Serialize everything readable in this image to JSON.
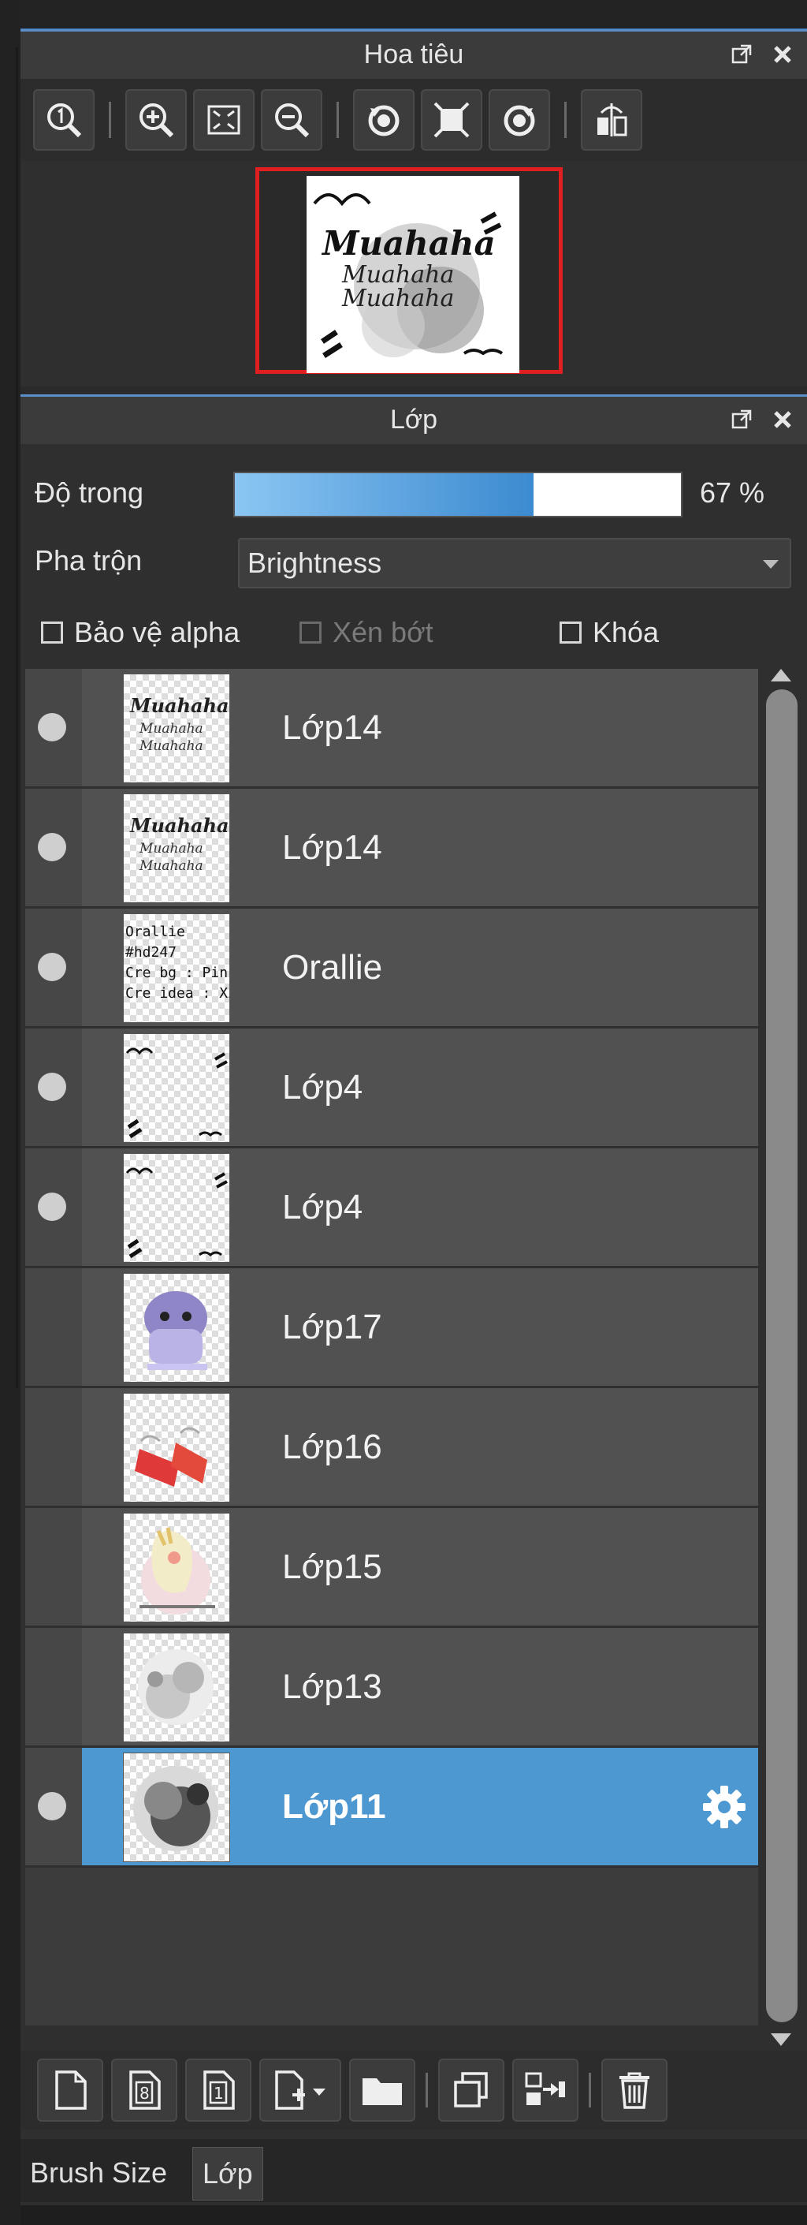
{
  "navigator": {
    "title": "Hoa tiêu",
    "preview_texts": [
      "Muahaha",
      "Muahaha",
      "Muahaha"
    ]
  },
  "layers_panel": {
    "title": "Lớp",
    "opacity": {
      "label": "Độ trong",
      "value_text": "67 %",
      "value": 0.67
    },
    "blend": {
      "label": "Pha trộn",
      "value": "Brightness"
    },
    "checks": [
      {
        "label": "Bảo vệ alpha",
        "checked": false,
        "enabled": true
      },
      {
        "label": "Xén bớt",
        "checked": false,
        "enabled": false
      },
      {
        "label": "Khóa",
        "checked": false,
        "enabled": true
      }
    ],
    "layers": [
      {
        "name": "Lớp14",
        "visible": true,
        "selected": false,
        "thumb": "text",
        "thumb_texts": [
          "Muahaha",
          "Muahaha",
          "Muahaha"
        ]
      },
      {
        "name": "Lớp14",
        "visible": true,
        "selected": false,
        "thumb": "text",
        "thumb_texts": [
          "Muahaha",
          "Muahaha",
          "Muahaha"
        ]
      },
      {
        "name": "Orallie",
        "visible": true,
        "selected": false,
        "thumb": "credits",
        "thumb_texts": [
          "Orallie",
          "#hd247",
          "Cre bg : Pin",
          "Cre idea : Xi"
        ]
      },
      {
        "name": "Lớp4",
        "visible": true,
        "selected": false,
        "thumb": "marks"
      },
      {
        "name": "Lớp4",
        "visible": true,
        "selected": false,
        "thumb": "marks"
      },
      {
        "name": "Lớp17",
        "visible": false,
        "selected": false,
        "thumb": "purple-figure"
      },
      {
        "name": "Lớp16",
        "visible": false,
        "selected": false,
        "thumb": "red-item"
      },
      {
        "name": "Lớp15",
        "visible": false,
        "selected": false,
        "thumb": "bird"
      },
      {
        "name": "Lớp13",
        "visible": false,
        "selected": false,
        "thumb": "gray-smudge"
      },
      {
        "name": "Lớp11",
        "visible": true,
        "selected": true,
        "thumb": "dark-smudge"
      }
    ]
  },
  "tabs": [
    {
      "label": "Brush Size",
      "active": false
    },
    {
      "label": "Lớp",
      "active": true
    }
  ],
  "colors": {
    "selected_row": "#4e98d1",
    "header_accent": "#5b8fc9",
    "navigator_frame": "#e02020"
  }
}
